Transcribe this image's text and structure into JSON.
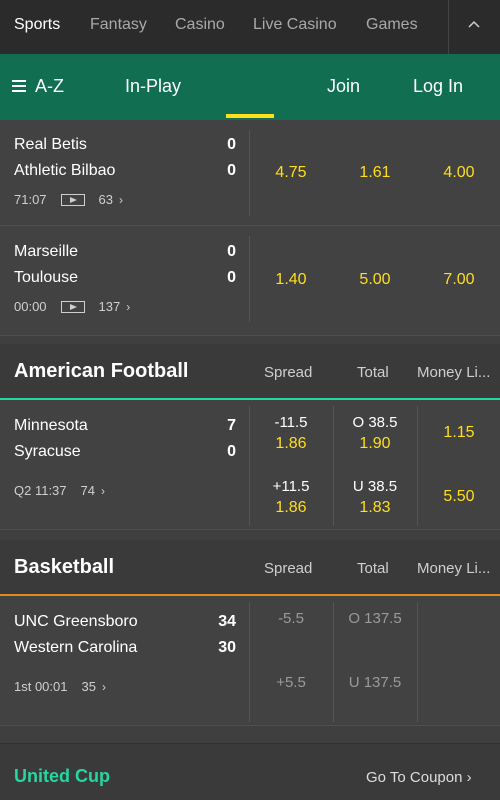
{
  "topnav": {
    "tabs": [
      {
        "label": "Sports",
        "active": true
      },
      {
        "label": "Fantasy"
      },
      {
        "label": "Casino"
      },
      {
        "label": "Live Casino"
      },
      {
        "label": "Games"
      }
    ],
    "collapse_icon": "chevron-up-icon"
  },
  "greenbar": {
    "az_label": "A-Z",
    "inplay_label": "In-Play",
    "join_label": "Join",
    "login_label": "Log In",
    "accent": "#ffdf1b",
    "background": "#126e51"
  },
  "soccer": [
    {
      "home": "Real Betis",
      "away": "Athletic Bilbao",
      "home_score": "0",
      "away_score": "0",
      "time": "71:07",
      "markets": "63",
      "odds": [
        "4.75",
        "1.61",
        "4.00"
      ]
    },
    {
      "home": "Marseille",
      "away": "Toulouse",
      "home_score": "0",
      "away_score": "0",
      "time": "00:00",
      "markets": "137",
      "odds": [
        "1.40",
        "5.00",
        "7.00"
      ]
    }
  ],
  "american_football": {
    "title": "American Football",
    "columns": [
      "Spread",
      "Total",
      "Money Li..."
    ],
    "border_color": "#26d6a0",
    "event": {
      "home": "Minnesota",
      "away": "Syracuse",
      "home_score": "7",
      "away_score": "0",
      "time": "Q2 11:37",
      "markets": "74",
      "home_spread_line": "-11.5",
      "home_spread_odds": "1.86",
      "home_total_line": "O 38.5",
      "home_total_odds": "1.90",
      "home_money": "1.15",
      "away_spread_line": "+11.5",
      "away_spread_odds": "1.86",
      "away_total_line": "U 38.5",
      "away_total_odds": "1.83",
      "away_money": "5.50"
    }
  },
  "basketball": {
    "title": "Basketball",
    "columns": [
      "Spread",
      "Total",
      "Money Li..."
    ],
    "border_color": "#e08a1e",
    "event": {
      "home": "UNC Greensboro",
      "away": "Western Carolina",
      "home_score": "34",
      "away_score": "30",
      "time": "1st 00:01",
      "markets": "35",
      "home_spread_line": "-5.5",
      "home_total_line": "O 137.5",
      "away_spread_line": "+5.5",
      "away_total_line": "U 137.5"
    }
  },
  "coupon": {
    "title": "United Cup",
    "link": "Go To Coupon",
    "title_color": "#26d6a0"
  }
}
